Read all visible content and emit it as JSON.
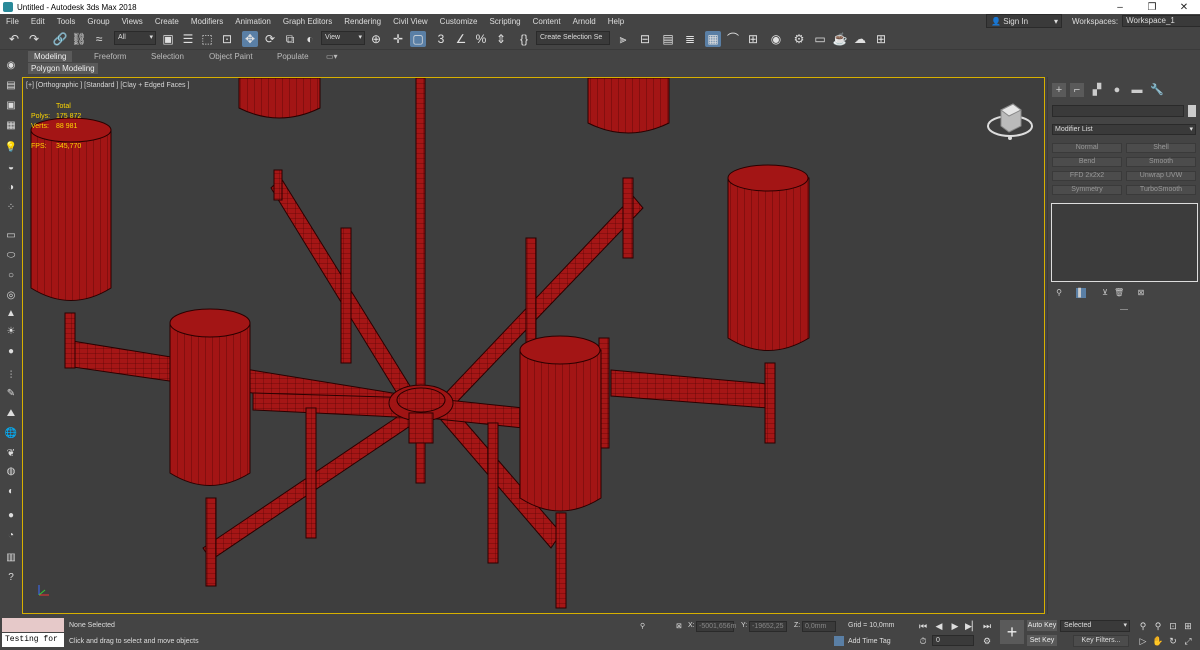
{
  "window": {
    "title": "Untitled - Autodesk 3ds Max 2018",
    "controls": [
      "–",
      "❐",
      "✕"
    ]
  },
  "menu": {
    "items": [
      "File",
      "Edit",
      "Tools",
      "Group",
      "Views",
      "Create",
      "Modifiers",
      "Animation",
      "Graph Editors",
      "Rendering",
      "Civil View",
      "Customize",
      "Scripting",
      "Content",
      "Arnold",
      "Help"
    ],
    "sign_in": "Sign In",
    "workspaces_label": "Workspaces:",
    "workspace_value": "Workspace_1"
  },
  "toolbar": {
    "selection_filter": "All",
    "coord_system": "View",
    "selection_set": "Create Selection Se"
  },
  "ribbon": {
    "tabs": [
      "Modeling",
      "Freeform",
      "Selection",
      "Object Paint",
      "Populate"
    ],
    "active_tab": "Modeling",
    "panel": "Polygon Modeling"
  },
  "viewport": {
    "label": "[+] [Orthographic ] [Standard ] [Clay + Edged Faces ]",
    "stats": {
      "header": "Total",
      "polys_label": "Polys:",
      "polys": "175 872",
      "verts_label": "Verts:",
      "verts": "88 981",
      "fps_label": "FPS:",
      "fps": "345,770"
    }
  },
  "command_panel": {
    "modifier_list": "Modifier List",
    "modifier_buttons": [
      "Normal",
      "Shell",
      "Bend",
      "Smooth",
      "FFD 2x2x2",
      "Unwrap UVW",
      "Symmetry",
      "TurboSmooth"
    ]
  },
  "status": {
    "maxscript_listener": "Testing for :",
    "selection": "None Selected",
    "prompt": "Click and drag to select and move objects",
    "x_label": "X:",
    "x": "-5001,656m",
    "y_label": "Y:",
    "y": "-19652,25",
    "z_label": "Z:",
    "z": "0,0mm",
    "grid": "Grid = 10,0mm",
    "add_time_tag": "Add Time Tag",
    "frame": "0",
    "auto_key": "Auto Key",
    "set_key": "Set Key",
    "key_mode": "Selected",
    "key_filters": "Key Filters..."
  },
  "colors": {
    "model": "#a01414",
    "model_edge": "#2a0000",
    "viewport_bg": "#3e3e3e",
    "active_border": "#d7b000",
    "stats_text": "#ffd700"
  }
}
